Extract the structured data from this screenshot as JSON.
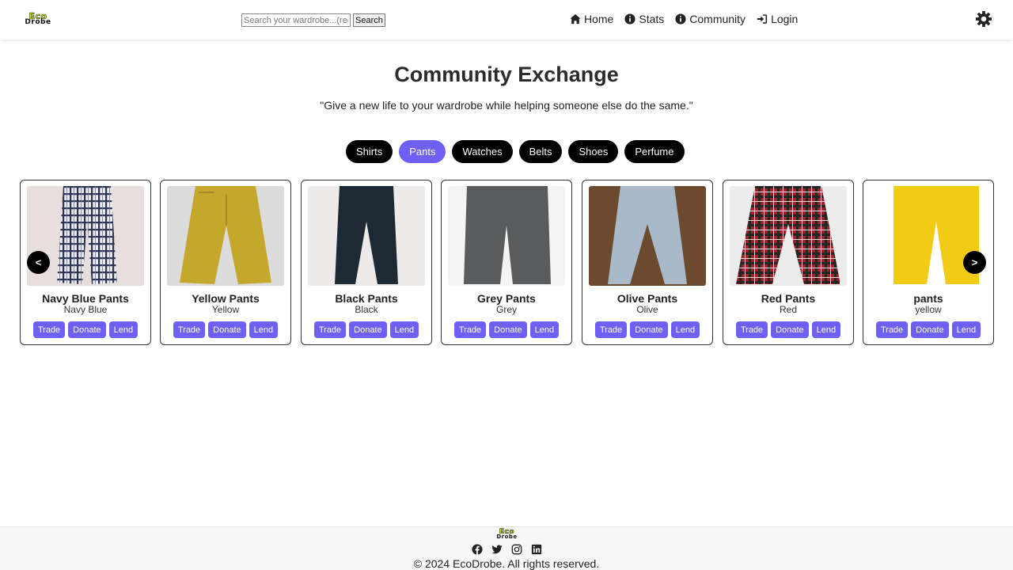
{
  "brand": {
    "line1": "Eco",
    "line2": "Drobe"
  },
  "search": {
    "placeholder": "Search your wardrobe...(red pants)",
    "button_label": "Search"
  },
  "nav": {
    "home": "Home",
    "stats": "Stats",
    "community": "Community",
    "login": "Login"
  },
  "page": {
    "title": "Community Exchange",
    "quote": "\"Give a new life to your wardrobe while helping someone else do the same.\""
  },
  "categories": [
    {
      "label": "Shirts",
      "active": false
    },
    {
      "label": "Pants",
      "active": true
    },
    {
      "label": "Watches",
      "active": false
    },
    {
      "label": "Belts",
      "active": false
    },
    {
      "label": "Shoes",
      "active": false
    },
    {
      "label": "Perfume",
      "active": false
    }
  ],
  "carousel": {
    "prev_label": "<",
    "next_label": ">"
  },
  "card_actions": {
    "trade": "Trade",
    "donate": "Donate",
    "lend": "Lend"
  },
  "items": [
    {
      "name": "Navy Blue Pants",
      "color": "Navy Blue"
    },
    {
      "name": "Yellow Pants",
      "color": "Yellow"
    },
    {
      "name": "Black Pants",
      "color": "Black"
    },
    {
      "name": "Grey Pants",
      "color": "Grey"
    },
    {
      "name": "Olive Pants",
      "color": "Olive"
    },
    {
      "name": "Red Pants",
      "color": "Red"
    },
    {
      "name": "pants",
      "color": "yellow"
    }
  ],
  "footer": {
    "copyright": "© 2024 EcoDrobe. All rights reserved."
  },
  "colors": {
    "accent": "#6e5ff5",
    "pill": "#000000",
    "logo_green": "#c6f016"
  }
}
